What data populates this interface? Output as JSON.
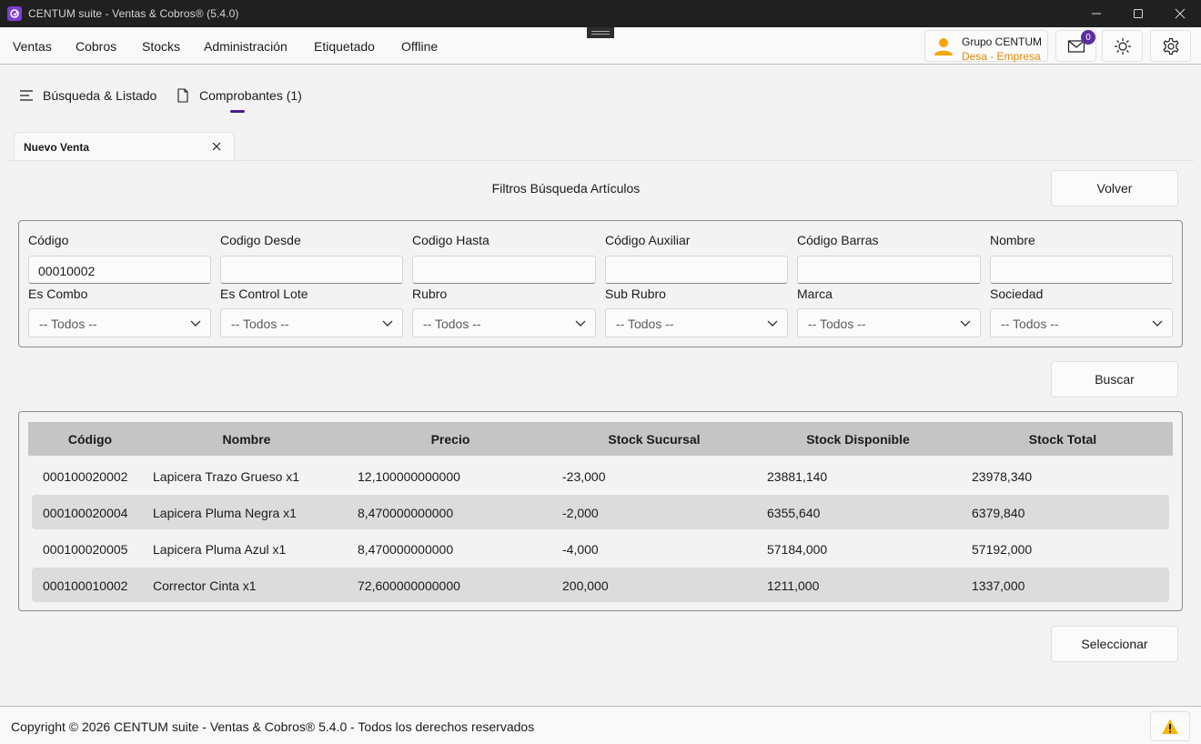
{
  "window": {
    "title": "CENTUM suite - Ventas & Cobros® (5.4.0)",
    "icon": "app-logo-icon",
    "controls": [
      "minimize-icon",
      "maximize-icon",
      "close-icon"
    ]
  },
  "menu": {
    "items": [
      "Ventas",
      "Cobros",
      "Stocks",
      "Administración",
      "Etiquetado",
      "Offline"
    ]
  },
  "user": {
    "name": "Grupo CENTUM",
    "company": "Desa - Empresa",
    "mail_count": "0"
  },
  "subnav": {
    "search_label": "Búsqueda & Listado",
    "vouchers_label": "Comprobantes (1)"
  },
  "doc_tab": {
    "label": "Nuevo Venta"
  },
  "filters": {
    "title": "Filtros Búsqueda Artículos",
    "back_label": "Volver",
    "search_label": "Buscar",
    "codigo_label": "Código",
    "codigo_value": "00010002",
    "desde_label": "Codigo Desde",
    "hasta_label": "Codigo Hasta",
    "auxiliar_label": "Código Auxiliar",
    "barras_label": "Código Barras",
    "nombre_label": "Nombre",
    "combo_label": "Es Combo",
    "lote_label": "Es Control Lote",
    "rubro_label": "Rubro",
    "subrubro_label": "Sub Rubro",
    "marca_label": "Marca",
    "sociedad_label": "Sociedad",
    "select_value": "-- Todos --"
  },
  "grid": {
    "headers": [
      "Código",
      "Nombre",
      "Precio",
      "Stock Sucursal",
      "Stock Disponible",
      "Stock Total"
    ],
    "rows": [
      [
        "000100020002",
        "Lapicera Trazo Grueso x1",
        "12,100000000000",
        "-23,000",
        "23881,140",
        "23978,340"
      ],
      [
        "000100020004",
        "Lapicera Pluma Negra x1",
        "8,470000000000",
        "-2,000",
        "6355,640",
        "6379,840"
      ],
      [
        "000100020005",
        "Lapicera Pluma Azul x1",
        "8,470000000000",
        "-4,000",
        "57184,000",
        "57192,000"
      ],
      [
        "000100010002",
        "Corrector Cinta x1",
        "72,600000000000",
        "200,000",
        "1211,000",
        "1337,000"
      ]
    ],
    "select_label": "Seleccionar"
  },
  "footer": {
    "text": "Copyright © 2026 CENTUM suite - Ventas & Cobros® 5.4.0 - Todos los derechos reservados",
    "warning_icon": "warning-icon"
  },
  "colors": {
    "accent": "#4b1d8f",
    "company": "#e08a00",
    "warning": "#f5b800"
  }
}
